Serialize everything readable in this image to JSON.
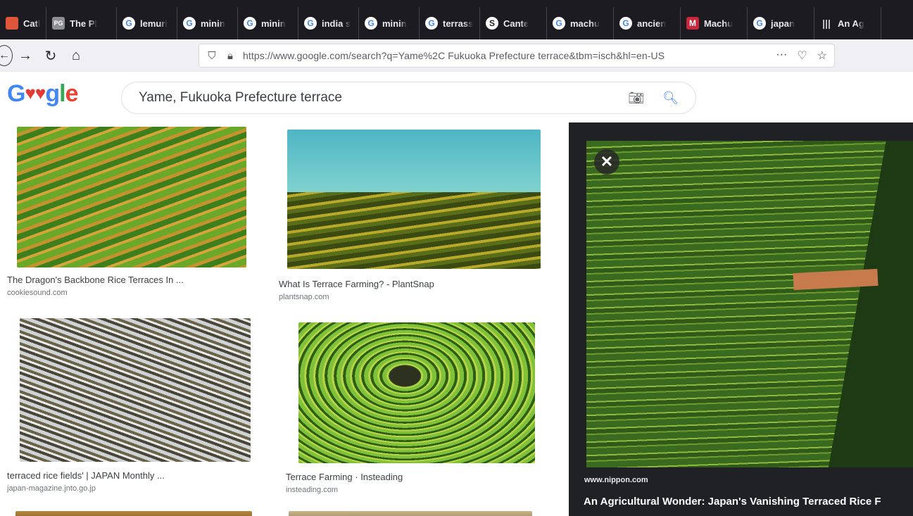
{
  "tabs": [
    {
      "label": "Cathol",
      "icon": "cathol-favicon-icon"
    },
    {
      "label": "The Pl",
      "icon": "pg-favicon-icon"
    },
    {
      "label": "lemuri",
      "icon": "google-icon"
    },
    {
      "label": "minin",
      "icon": "google-icon"
    },
    {
      "label": "minin",
      "icon": "google-icon"
    },
    {
      "label": "india s",
      "icon": "google-icon"
    },
    {
      "label": "minin",
      "icon": "google-icon"
    },
    {
      "label": "terrass",
      "icon": "google-icon"
    },
    {
      "label": "Cante",
      "icon": "s-favicon-icon"
    },
    {
      "label": "machu",
      "icon": "google-icon"
    },
    {
      "label": "ancien",
      "icon": "google-icon"
    },
    {
      "label": "Machu",
      "icon": "m-favicon-icon"
    },
    {
      "label": "japan",
      "icon": "google-icon"
    },
    {
      "label": "An Ag",
      "icon": "bars-icon"
    }
  ],
  "nav": {
    "url": "https://www.google.com/search?q=Yame%2C Fukuoka Prefecture terrace&tbm=isch&hl=en-US",
    "more": "···"
  },
  "search": {
    "query": "Yame, Fukuoka Prefecture terrace"
  },
  "results": [
    {
      "caption": "The Dragon's Backbone Rice Terraces In ...",
      "source": "cookiesound.com"
    },
    {
      "caption": "What Is Terrace Farming? - PlantSnap",
      "source": "plantsnap.com"
    },
    {
      "caption": "terraced rice fields' | JAPAN Monthly ...",
      "source": "japan-magazine.jnto.go.jp"
    },
    {
      "caption": "Terrace Farming · Insteading",
      "source": "insteading.com"
    }
  ],
  "preview": {
    "close": "✕",
    "source": "www.nippon.com",
    "title": "An Agricultural Wonder: Japan's Vanishing Terraced Rice F"
  }
}
